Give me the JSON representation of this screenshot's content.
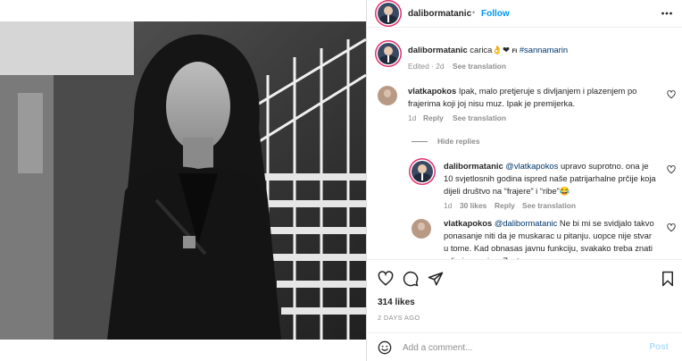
{
  "header": {
    "username": "dalibormatanic",
    "dot": "•",
    "follow_label": "Follow",
    "more_glyph": "•••"
  },
  "caption": {
    "username": "dalibormatanic",
    "text": "carica",
    "emoji": "👌❤",
    "flag": "FI",
    "hashtag": "#sannamarin",
    "edited": "Edited · 2d",
    "see_translation": "See translation"
  },
  "comments": [
    {
      "username": "vlatkapokos",
      "text": "Ipak, malo pretjeruje s divljanjem i plazenjem po frajerima koji joj nisu muz. Ipak je premijerka.",
      "age": "1d",
      "reply": "Reply",
      "see_translation": "See translation"
    }
  ],
  "hide_replies": "Hide replies",
  "replies": [
    {
      "username": "dalibormatanic",
      "mention": "@vlatkapokos",
      "text": "upravo suprotno. ona je 10 svjetlosnih godina ispred naše patrijarhalne prčije koja dijeli društvo na “frajere” i “ribe”😂",
      "age": "1d",
      "likes": "30 likes",
      "reply": "Reply",
      "see_translation": "See translation"
    },
    {
      "username": "vlatkapokos",
      "mention": "@dalibormatanic",
      "text": "Ne bi mi se svidjalo takvo ponasanje niti da je muskarac u pitanju. uopce nije stvar u tome. Kad obnasas javnu funkciju, ",
      "overflow": "svakako treba znati gdje je granica. Zasto..."
    }
  ],
  "actions": {
    "likes": "314 likes",
    "date": "2 DAYS AGO"
  },
  "add_comment": {
    "placeholder": "Add a comment...",
    "post_label": "Post"
  },
  "icons": {
    "more": "more-horizontal-icon",
    "heart": "heart-icon",
    "comment": "comment-icon",
    "share": "share-icon",
    "save": "bookmark-icon",
    "emoji": "emoji-icon"
  },
  "colors": {
    "follow": "#0095f6",
    "link": "#00376b",
    "muted": "#8e8e8e",
    "post_disabled": "#b2dffc"
  }
}
